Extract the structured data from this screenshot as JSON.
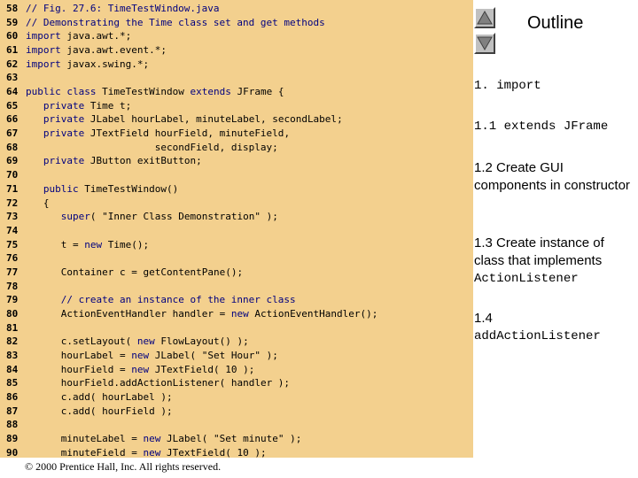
{
  "code_lines": [
    {
      "n": "58",
      "t": "// Fig. 27.6: TimeTestWindow.java"
    },
    {
      "n": "59",
      "t": "// Demonstrating the Time class set and get methods"
    },
    {
      "n": "60",
      "t": "import java.awt.*;"
    },
    {
      "n": "61",
      "t": "import java.awt.event.*;"
    },
    {
      "n": "62",
      "t": "import javax.swing.*;"
    },
    {
      "n": "63",
      "t": ""
    },
    {
      "n": "64",
      "t": "public class TimeTestWindow extends JFrame {"
    },
    {
      "n": "65",
      "t": "   private Time t;"
    },
    {
      "n": "66",
      "t": "   private JLabel hourLabel, minuteLabel, secondLabel;"
    },
    {
      "n": "67",
      "t": "   private JTextField hourField, minuteField,"
    },
    {
      "n": "68",
      "t": "                      secondField, display;"
    },
    {
      "n": "69",
      "t": "   private JButton exitButton;"
    },
    {
      "n": "70",
      "t": ""
    },
    {
      "n": "71",
      "t": "   public TimeTestWindow()"
    },
    {
      "n": "72",
      "t": "   {"
    },
    {
      "n": "73",
      "t": "      super( \"Inner Class Demonstration\" );"
    },
    {
      "n": "74",
      "t": ""
    },
    {
      "n": "75",
      "t": "      t = new Time();"
    },
    {
      "n": "76",
      "t": ""
    },
    {
      "n": "77",
      "t": "      Container c = getContentPane();"
    },
    {
      "n": "78",
      "t": ""
    },
    {
      "n": "79",
      "t": "      // create an instance of the inner class"
    },
    {
      "n": "80",
      "t": "      ActionEventHandler handler = new ActionEventHandler();"
    },
    {
      "n": "81",
      "t": ""
    },
    {
      "n": "82",
      "t": "      c.setLayout( new FlowLayout() );"
    },
    {
      "n": "83",
      "t": "      hourLabel = new JLabel( \"Set Hour\" );"
    },
    {
      "n": "84",
      "t": "      hourField = new JTextField( 10 );"
    },
    {
      "n": "85",
      "t": "      hourField.addActionListener( handler );"
    },
    {
      "n": "86",
      "t": "      c.add( hourLabel );"
    },
    {
      "n": "87",
      "t": "      c.add( hourField );"
    },
    {
      "n": "88",
      "t": ""
    },
    {
      "n": "89",
      "t": "      minuteLabel = new JLabel( \"Set minute\" );"
    },
    {
      "n": "90",
      "t": "      minuteField = new JTextField( 10 );"
    }
  ],
  "nav": {
    "up_icon": "triangle-up-icon",
    "down_icon": "triangle-down-icon"
  },
  "outline": {
    "title": "Outline",
    "item1": "1. import",
    "item2": "1.1 extends JFrame",
    "item3": "1.2 Create GUI components in constructor",
    "item4_text": "1.3 Create instance of class that implements",
    "item4_code": "ActionListener",
    "item5_num": "1.4",
    "item5_code": "addActionListener"
  },
  "footer": "© 2000 Prentice Hall, Inc.  All rights reserved.",
  "colors": {
    "code_bg": "#f3d08e",
    "keyword": "#00007f",
    "button_face": "#c0c0c0"
  }
}
